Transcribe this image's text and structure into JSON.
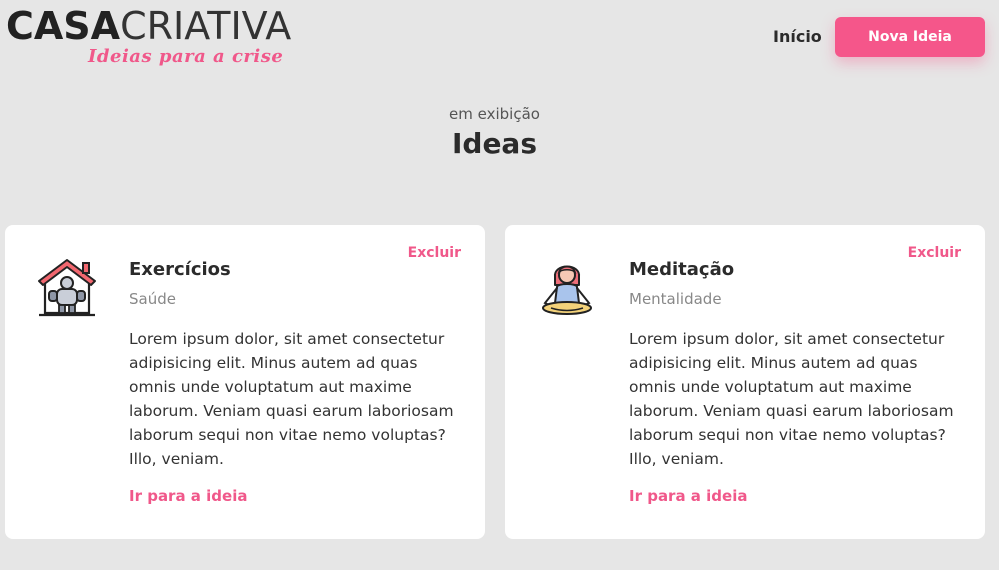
{
  "header": {
    "logo_bold": "CASA",
    "logo_light": "CRIATIVA",
    "logo_tagline": "Ideias para a crise",
    "nav_home": "Início",
    "new_idea_button": "Nova Ideia"
  },
  "main": {
    "subtitle": "em exibição",
    "title": "Ideas"
  },
  "ideas": [
    {
      "icon": "home-exercise-icon",
      "title": "Exercícios",
      "category": "Saúde",
      "description": "Lorem ipsum dolor, sit amet consectetur adipisicing elit. Minus autem ad quas omnis unde voluptatum aut maxime laborum. Veniam quasi earum laboriosam laborum sequi non vitae nemo voluptas? Illo, veniam.",
      "delete_label": "Excluir",
      "link_label": "Ir para a ideia"
    },
    {
      "icon": "meditation-icon",
      "title": "Meditação",
      "category": "Mentalidade",
      "description": "Lorem ipsum dolor, sit amet consectetur adipisicing elit. Minus autem ad quas omnis unde voluptatum aut maxime laborum. Veniam quasi earum laboriosam laborum sequi non vitae nemo voluptas? Illo, veniam.",
      "delete_label": "Excluir",
      "link_label": "Ir para a ideia"
    }
  ],
  "colors": {
    "accent": "#f5568a",
    "background": "#e6e6e6",
    "card": "#ffffff"
  }
}
